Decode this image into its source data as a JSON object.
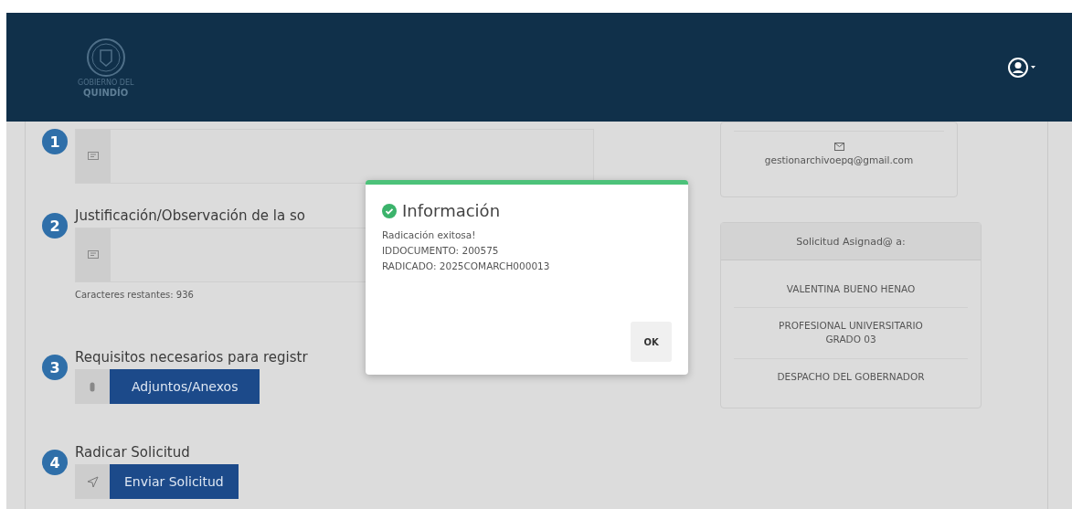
{
  "header": {
    "logo_top": "GOBIERNO DEL",
    "logo_name": "QUINDÍO"
  },
  "steps": [
    {
      "number": "1",
      "kind": "field"
    },
    {
      "number": "2",
      "title": "Justificación/Observación de la so",
      "kind": "field",
      "note": "Caracteres restantes: 936"
    },
    {
      "number": "3",
      "title": "Requisitos necesarios para registr",
      "kind": "attach",
      "button": "Adjuntos/Anexos"
    },
    {
      "number": "4",
      "title": "Radicar Solicitud",
      "kind": "send",
      "button": "Enviar Solicitud"
    }
  ],
  "contact": {
    "email": "gestionarchivoepq@gmail.com"
  },
  "assigned": {
    "title": "Solicitud Asignad@ a:",
    "rows": [
      "VALENTINA BUENO HENAO",
      "PROFESIONAL UNIVERSITARIO GRADO 03",
      "DESPACHO DEL GOBERNADOR"
    ]
  },
  "dialog": {
    "title": "Información",
    "lines": [
      "Radicación exitosa!",
      "IDDOCUMENTO: 200575",
      "RADICADO: 2025COMARCH000013"
    ],
    "button": "OK"
  }
}
